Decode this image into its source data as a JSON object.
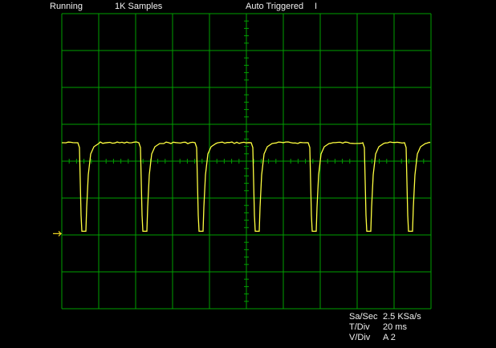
{
  "status": {
    "run_state": "Running",
    "samples": "1K Samples",
    "trigger_mode": "Auto Triggered",
    "cursor": "I"
  },
  "screen": {
    "divisions_x": 10,
    "divisions_y": 8,
    "grid_color": "#00a000",
    "trace_color": "#ffff40",
    "marker_color": "#e8d020"
  },
  "chart_data": {
    "type": "line",
    "series": [
      {
        "channel": "A",
        "waveform": "periodic negative-going pulse train",
        "pulse_count": 7,
        "high_level_div": 0.5,
        "low_level_div": -1.9,
        "pulse_period_div": 1.65
      }
    ],
    "grid": true
  },
  "readouts": [
    {
      "label": "Sa/Sec",
      "value": "2.5 KSa/s"
    },
    {
      "label": "T/Div",
      "value": "20 ms"
    },
    {
      "label": "V/Div",
      "value": "A 2"
    }
  ]
}
